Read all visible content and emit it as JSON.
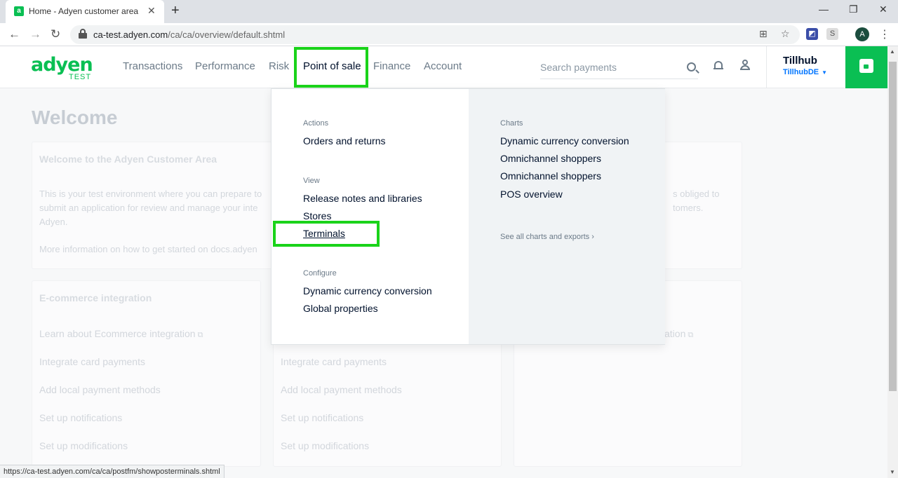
{
  "browser": {
    "tab_title": "Home - Adyen customer area",
    "favicon_letter": "a",
    "url_host": "ca-test.adyen.com",
    "url_path": "/ca/ca/overview/default.shtml",
    "profile_initial": "A",
    "status_url": "https://ca-test.adyen.com/ca/ca/postfm/showposterminals.shtml"
  },
  "header": {
    "logo": "adyen",
    "logo_sub": "TEST",
    "nav": [
      "Transactions",
      "Performance",
      "Risk",
      "Point of sale",
      "Finance",
      "Account"
    ],
    "search_placeholder": "Search payments",
    "account_name": "Tillhub",
    "account_sub": "TillhubDE",
    "accent_color": "#0abf53"
  },
  "page": {
    "title": "Welcome",
    "welcome_card": {
      "title": "Welcome to the Adyen Customer Area",
      "line1": "This is your test environment where you can prepare to",
      "line2": "submit an application for review and manage your inte",
      "line3": "Adyen.",
      "line4": "More information on how to get started on docs.adyen",
      "right_line1": "s obliged to",
      "right_line2": "tomers."
    },
    "ecom_card": {
      "title": "E-commerce integration",
      "links": [
        "Learn about Ecommerce integration",
        "Integrate card payments",
        "Add local payment methods",
        "Set up notifications",
        "Set up modifications"
      ]
    },
    "middle_card": {
      "links": [
        "Integrate card payments",
        "Add local payment methods",
        "Set up notifications",
        "Set up modifications"
      ]
    },
    "right_card": {
      "link_fragment": "ation"
    }
  },
  "dropdown": {
    "actions_heading": "Actions",
    "actions": [
      "Orders and returns"
    ],
    "view_heading": "View",
    "view": [
      "Release notes and libraries",
      "Stores",
      "Terminals"
    ],
    "configure_heading": "Configure",
    "configure": [
      "Dynamic currency conversion",
      "Global properties"
    ],
    "charts_heading": "Charts",
    "charts": [
      "Dynamic currency conversion",
      "Omnichannel shoppers",
      "Omnichannel shoppers",
      "POS overview"
    ],
    "see_all": "See all charts and exports"
  }
}
